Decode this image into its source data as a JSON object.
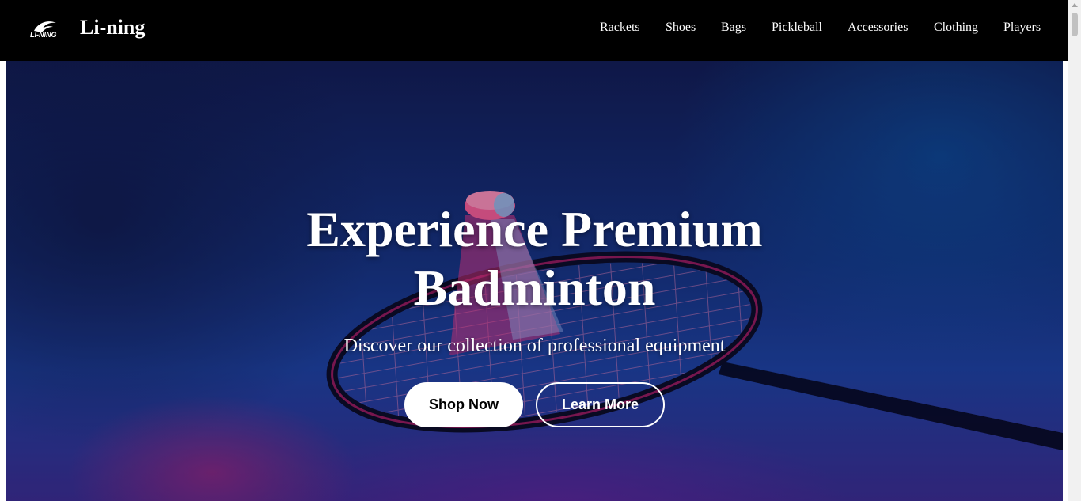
{
  "header": {
    "logo_text": "LI-NING",
    "brand": "Li-ning",
    "nav": [
      {
        "label": "Rackets"
      },
      {
        "label": "Shoes"
      },
      {
        "label": "Bags"
      },
      {
        "label": "Pickleball"
      },
      {
        "label": "Accessories"
      },
      {
        "label": "Clothing"
      },
      {
        "label": "Players"
      }
    ]
  },
  "hero": {
    "title_line1": "Experience Premium",
    "title_line2": "Badminton",
    "subtitle": "Discover our collection of professional equipment",
    "primary_button": "Shop Now",
    "secondary_button": "Learn More",
    "image_icon": "badminton-racket-shuttlecock-image"
  },
  "colors": {
    "header_bg": "#000000",
    "text": "#ffffff",
    "hero_blue": "#15307a",
    "hero_magenta": "#be1e6e",
    "button_primary_bg": "#ffffff",
    "button_primary_text": "#000000"
  },
  "icons": {
    "logo": "li-ning-logo-icon"
  }
}
